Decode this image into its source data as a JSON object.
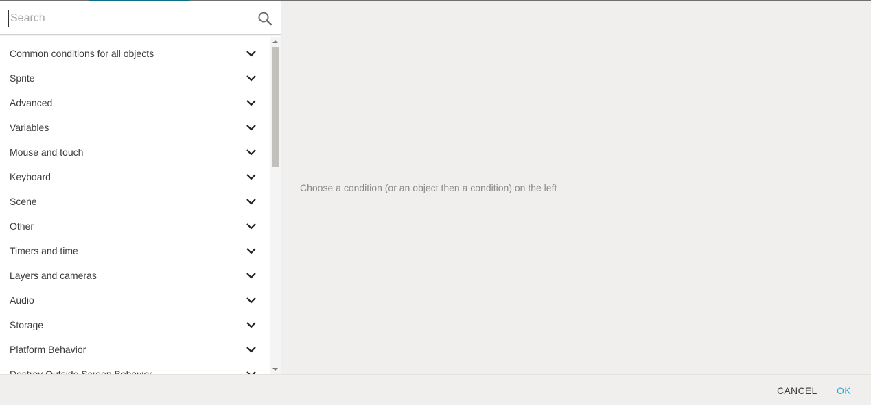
{
  "search": {
    "placeholder": "Search"
  },
  "conditions": {
    "groups": [
      {
        "label": "Common conditions for all objects",
        "icon": "chevron-down-icon"
      },
      {
        "label": "Sprite",
        "icon": "chevron-down-icon"
      },
      {
        "label": "Advanced",
        "icon": "chevron-down-icon"
      },
      {
        "label": "Variables",
        "icon": "chevron-down-icon"
      },
      {
        "label": "Mouse and touch",
        "icon": "chevron-down-icon"
      },
      {
        "label": "Keyboard",
        "icon": "chevron-down-icon"
      },
      {
        "label": "Scene",
        "icon": "chevron-down-icon"
      },
      {
        "label": "Other",
        "icon": "chevron-down-icon"
      },
      {
        "label": "Timers and time",
        "icon": "chevron-down-icon"
      },
      {
        "label": "Layers and cameras",
        "icon": "chevron-down-icon"
      },
      {
        "label": "Audio",
        "icon": "chevron-down-icon"
      },
      {
        "label": "Storage",
        "icon": "chevron-down-icon"
      },
      {
        "label": "Platform Behavior",
        "icon": "chevron-down-icon"
      },
      {
        "label": "Destroy Outside Screen Behavior",
        "icon": "chevron-down-icon"
      }
    ]
  },
  "main": {
    "empty_hint": "Choose a condition (or an object then a condition) on the left"
  },
  "footer": {
    "cancel_label": "CANCEL",
    "ok_label": "OK"
  },
  "colors": {
    "accent": "#2aa6d4",
    "tab_indicator": "#0b6f87",
    "pane_background": "#f0efed"
  }
}
